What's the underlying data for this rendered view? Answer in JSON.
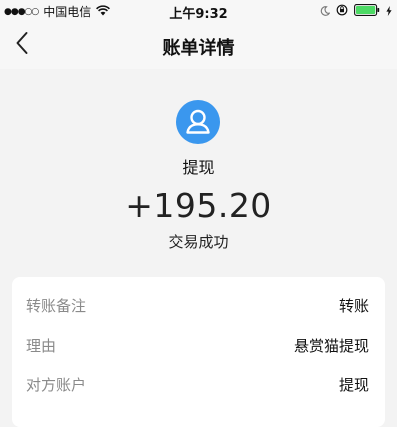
{
  "status_bar": {
    "signal": "●●●○○",
    "carrier": "中国电信",
    "wifi_icon": "wifi-icon",
    "time": "上午9:32",
    "icons": [
      "moon-icon",
      "orientation-lock-icon",
      "battery-icon",
      "charging-bolt-icon"
    ],
    "battery_color": "#4cd964"
  },
  "nav": {
    "back_icon": "chevron-left-icon",
    "title": "账单详情"
  },
  "transaction": {
    "avatar_icon": "user-avatar-icon",
    "avatar_color": "#3a97ee",
    "type": "提现",
    "amount": "+195.20",
    "status": "交易成功"
  },
  "details": [
    {
      "label": "转账备注",
      "value": "转账"
    },
    {
      "label": "理由",
      "value": "悬赏猫提现"
    },
    {
      "label": "对方账户",
      "value": "提现"
    }
  ]
}
